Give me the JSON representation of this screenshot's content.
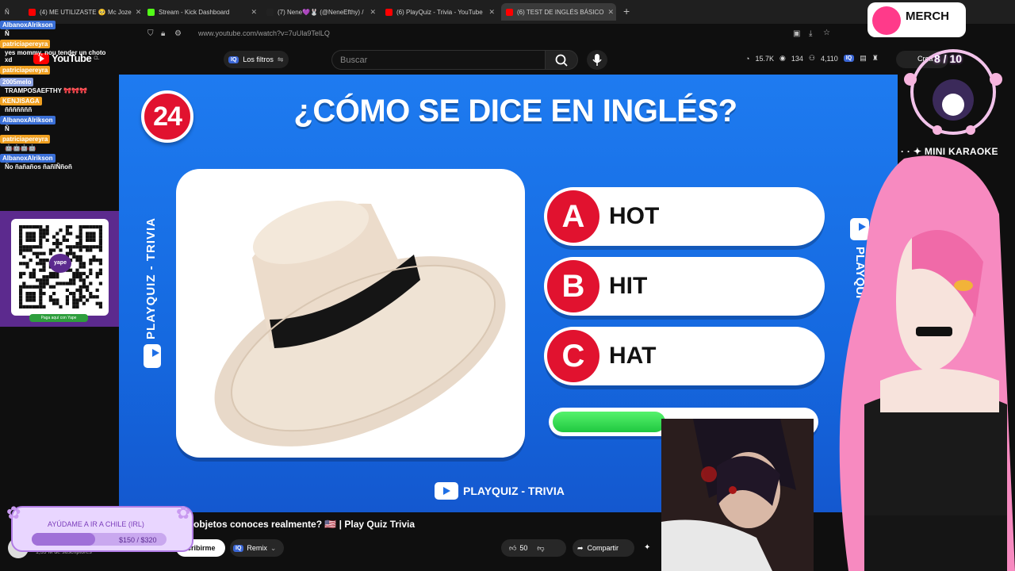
{
  "browser": {
    "tabs": [
      {
        "label": "Ñ",
        "active": false
      },
      {
        "label": "(4) ME UTILIZASTE 🥺 Mc Joze",
        "active": false
      },
      {
        "label": "Stream - Kick Dashboard",
        "active": false
      },
      {
        "label": "(7) Nene💜🐰 (@NeneEfthy) /",
        "active": false
      },
      {
        "label": "(6) PlayQuiz - Trivia - YouTube",
        "active": false
      },
      {
        "label": "(6) TEST DE INGLÉS BÁSICO",
        "active": true
      }
    ],
    "url": "www.youtube.com/watch?v=7uUla9TelLQ"
  },
  "youtube": {
    "logo_text": "YouTube",
    "country": "CL",
    "filters_label": "Los filtros",
    "search_placeholder": "Buscar",
    "stats": {
      "views": "15.7K",
      "watching": "134",
      "count": "4,110"
    },
    "create_label": "Crea"
  },
  "video": {
    "question_number": "24",
    "question": "¿CÓMO SE DICE EN INGLÉS?",
    "answers": [
      {
        "letter": "A",
        "text": "HOT"
      },
      {
        "letter": "B",
        "text": "HIT"
      },
      {
        "letter": "C",
        "text": "HAT"
      }
    ],
    "timer_fraction": 0.43,
    "brand_side": "PLAYQUIZ - TRIVIA",
    "brand_right": "PLAYQUI",
    "brand_bottom": "PLAYQUIZ - TRIVIA",
    "title": "s objetos conoces realmente? 🇺🇸 | Play Quiz Trivia",
    "subscribers": "1,39 M de suscriptores",
    "subscribe_label": "ascribirme",
    "remix_label": "Remix",
    "likes": "50",
    "share_label": "Compartir"
  },
  "chat": [
    {
      "name": "AlbanoxAlrikson",
      "name_color": "#3a6fd6",
      "msg": "Ñ"
    },
    {
      "name": "patriciapereyra",
      "name_color": "#f0a020",
      "msg": "yes mommy, nou tender un choto xd"
    },
    {
      "name": "patriciapereyra",
      "name_color": "#f0a020",
      "msg": ""
    },
    {
      "name": "2005melo",
      "name_color": "#8aa0e0",
      "msg": "TRAMPOSAEFTHY 🎀🎀🎀"
    },
    {
      "name": "KENJISAGA",
      "name_color": "#f0a020",
      "msg": "ñññññññ"
    },
    {
      "name": "AlbanoxAlrikson",
      "name_color": "#3a6fd6",
      "msg": "Ñ"
    },
    {
      "name": "patriciapereyra",
      "name_color": "#f0a020",
      "msg": "🤖🤖🤖🤖"
    },
    {
      "name": "AlbanoxAlrikson",
      "name_color": "#3a6fd6",
      "msg": "Ño ñañaños ñañlÑñoñ"
    }
  ],
  "qr_label": "Paga aquí con Yape",
  "qr_brand": "yape",
  "goal": {
    "title": "AYÚDAME A IR A CHILE (IRL)",
    "amount": "$150 / $320",
    "fraction": 0.47
  },
  "overlay": {
    "merch": "MERCH",
    "counter": "8 / 10",
    "karaoke": "· · ✦ MINI KARAOKE"
  },
  "colors": {
    "accent_red": "#e1122f",
    "video_blue": "#1e6fe6",
    "timer_green": "#2fd44f"
  }
}
